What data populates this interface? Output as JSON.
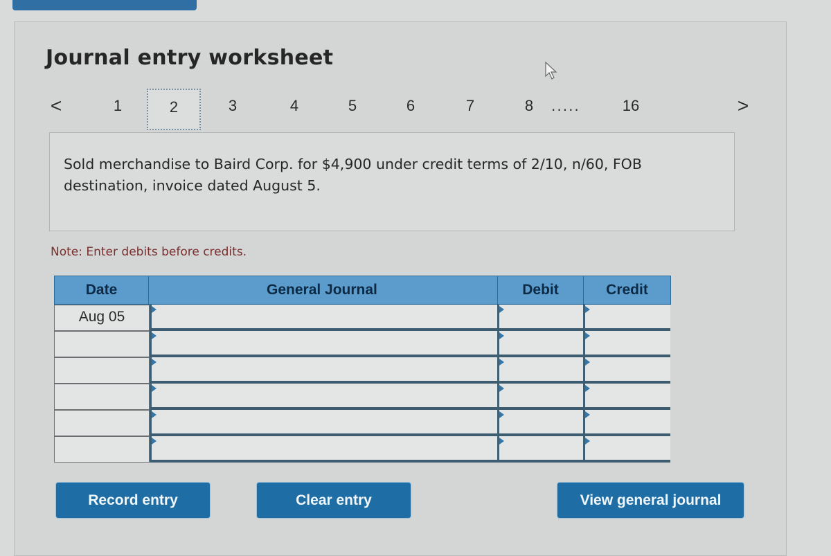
{
  "worksheet": {
    "title": "Journal entry worksheet",
    "pager": {
      "prev_icon": "chevron-left-icon",
      "prev_glyph": "<",
      "next_icon": "chevron-right-icon",
      "next_glyph": ">",
      "pages": [
        "1",
        "2",
        "3",
        "4",
        "5",
        "6",
        "7",
        "8"
      ],
      "ellipsis": ".....",
      "last_page": "16",
      "active_page": "2"
    },
    "description": "Sold merchandise to Baird Corp. for $4,900 under credit terms of 2/10, n/60, FOB destination, invoice dated August 5.",
    "note": "Note: Enter debits before credits."
  },
  "journal": {
    "headers": {
      "date": "Date",
      "general_journal": "General Journal",
      "debit": "Debit",
      "credit": "Credit"
    },
    "rows": [
      {
        "date": "Aug 05",
        "account": "",
        "debit": "",
        "credit": ""
      },
      {
        "date": "",
        "account": "",
        "debit": "",
        "credit": ""
      },
      {
        "date": "",
        "account": "",
        "debit": "",
        "credit": ""
      },
      {
        "date": "",
        "account": "",
        "debit": "",
        "credit": ""
      },
      {
        "date": "",
        "account": "",
        "debit": "",
        "credit": ""
      },
      {
        "date": "",
        "account": "",
        "debit": "",
        "credit": ""
      }
    ]
  },
  "buttons": {
    "record": "Record entry",
    "clear": "Clear entry",
    "view_journal": "View general journal"
  },
  "colors": {
    "header_blue": "#5b9ccd",
    "button_blue": "#1e6ea5",
    "note_red": "#7a2e2e"
  }
}
